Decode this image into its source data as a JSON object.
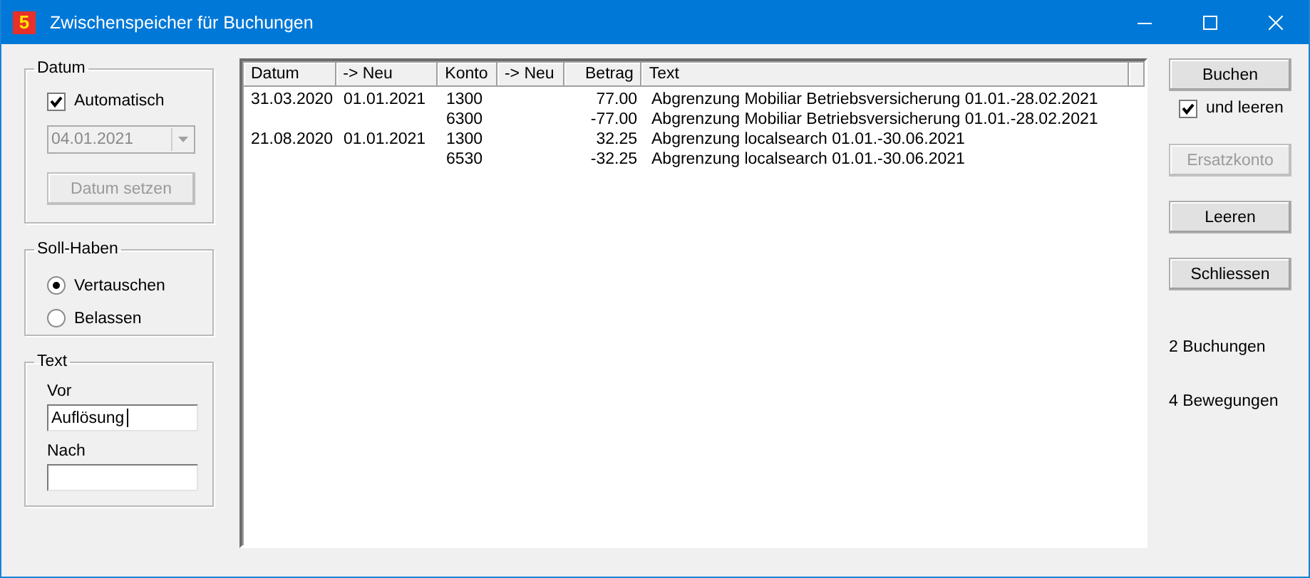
{
  "window": {
    "icon_label": "5",
    "title": "Zwischenspeicher für Buchungen"
  },
  "datum": {
    "label": "Datum",
    "automatic": {
      "label": "Automatisch",
      "checked": true
    },
    "date_field": {
      "value": "04.01.2021",
      "disabled": true
    },
    "set_button": {
      "label": "Datum setzen",
      "disabled": true
    }
  },
  "soll_haben": {
    "label": "Soll-Haben",
    "options": [
      {
        "label": "Vertauschen",
        "selected": true
      },
      {
        "label": "Belassen",
        "selected": false
      }
    ]
  },
  "text": {
    "label": "Text",
    "fields": [
      {
        "label": "Vor",
        "value": "Auflösung",
        "focused": true
      },
      {
        "label": "Nach",
        "focused": false
      }
    ]
  },
  "table": {
    "columns": [
      "Datum",
      "-> Neu",
      "Konto",
      "-> Neu",
      "Betrag",
      "Text"
    ],
    "rows": [
      [
        "31.03.2020",
        "01.01.2021",
        "1300",
        "",
        "77.00",
        "Abgrenzung Mobiliar Betriebsversicherung 01.01.-28.02.2021"
      ],
      [
        "",
        "",
        "6300",
        "",
        "-77.00",
        "Abgrenzung Mobiliar Betriebsversicherung 01.01.-28.02.2021"
      ],
      [
        "21.08.2020",
        "01.01.2021",
        "1300",
        "",
        "32.25",
        "Abgrenzung localsearch 01.01.-30.06.2021"
      ],
      [
        "",
        "",
        "6530",
        "",
        "-32.25",
        "Abgrenzung localsearch 01.01.-30.06.2021"
      ]
    ]
  },
  "actions": [
    {
      "kind": "button",
      "label": "Buchen",
      "disabled": false
    },
    {
      "kind": "checkbox",
      "label": "und leeren",
      "checked": true
    },
    {
      "kind": "button",
      "label": "Ersatzkonto",
      "disabled": true
    },
    {
      "kind": "button",
      "label": "Leeren",
      "disabled": false
    },
    {
      "kind": "button",
      "label": "Schliessen",
      "disabled": false
    }
  ],
  "counts": [
    "2 Buchungen",
    "4 Bewegungen"
  ]
}
